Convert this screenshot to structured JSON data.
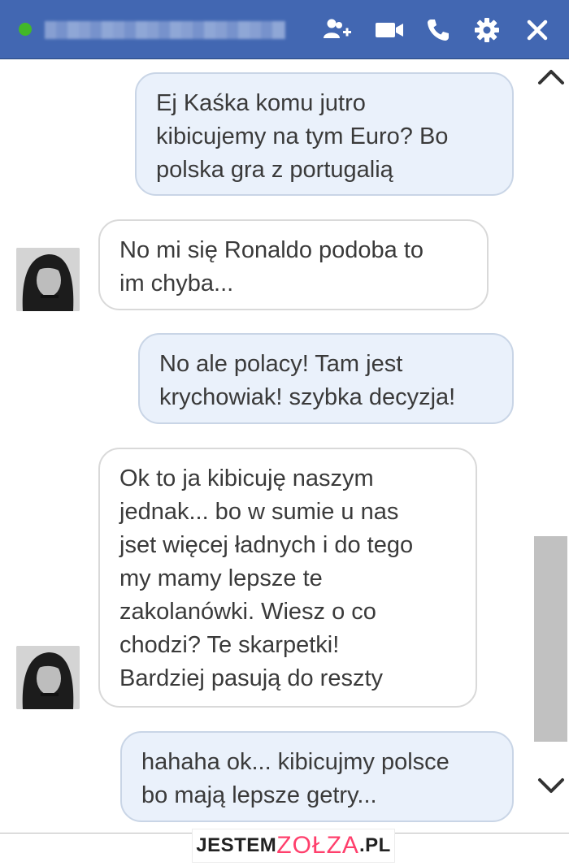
{
  "header": {
    "contact_name_redacted": true,
    "icons": [
      "add-people-icon",
      "video-call-icon",
      "phone-icon",
      "gear-icon",
      "close-icon"
    ]
  },
  "messages": [
    {
      "side": "out",
      "text": "Ej Kaśka komu jutro\nkibicujemy na tym Euro? Bo\npolska gra z portugalią"
    },
    {
      "side": "in",
      "text": "No mi się Ronaldo podoba to\nim chyba..."
    },
    {
      "side": "out",
      "text": "No ale polacy! Tam jest\nkrychowiak! szybka decyzja!"
    },
    {
      "side": "in",
      "text": "Ok to ja kibicuję naszym\njednak... bo w sumie u nas\njset więcej ładnych i do tego\nmy mamy lepsze te\nzakolanówki. Wiesz o co\nchodzi? Te skarpetki!\nBardziej pasują do reszty"
    },
    {
      "side": "out",
      "text": "hahaha ok... kibicujmy polsce\nbo mają lepsze getry..."
    }
  ],
  "watermark": {
    "part1": "JESTEM",
    "part2": "ZOŁZA",
    "part3": ".PL"
  },
  "colors": {
    "titlebar": "#4267b2",
    "online": "#42b72a",
    "outgoing_bubble": "#eaf1fb",
    "incoming_bubble": "#ffffff",
    "watermark_accent": "#ff3f6c"
  }
}
